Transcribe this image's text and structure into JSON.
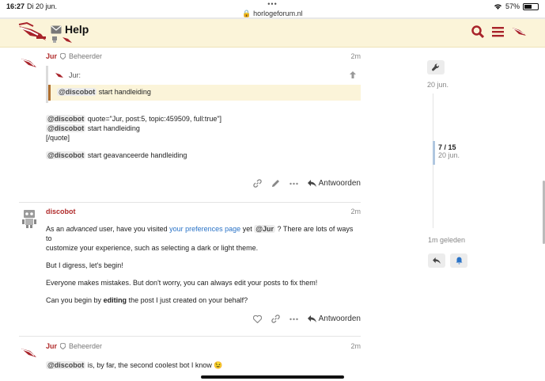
{
  "status": {
    "time": "16:27",
    "date": "Di 20 jun.",
    "url": "horlogeforum.nl",
    "battery": "57%",
    "battery_level": 0.57,
    "dots": "•••"
  },
  "header": {
    "title": "Help"
  },
  "posts": [
    {
      "username": "Jur",
      "role": "Beheerder",
      "time": "2m",
      "quote_author": "Jur:",
      "quote_mention": "@discobot",
      "quote_text": "start handleiding",
      "lines": [
        {
          "mention": "@discobot",
          "text": "quote=\"Jur, post:5, topic:459509, full:true\"]"
        },
        {
          "mention": "@discobot",
          "text": "start handleiding"
        },
        {
          "mention": "",
          "text": "[/quote]"
        },
        {
          "mention": "@discobot",
          "text": "start geavanceerde handleiding"
        }
      ],
      "reply_label": "Antwoorden"
    },
    {
      "username": "discobot",
      "time": "2m",
      "p1_a": "As an ",
      "p1_em": "advanced",
      "p1_b": " user, have you visited ",
      "p1_link": "your preferences page",
      "p1_c": " yet ",
      "p1_mention": "@Jur",
      "p1_d": " ? There are lots of ways to",
      "p1_e": "customize your experience, such as selecting a dark or light theme.",
      "p2": "But I digress, let's begin!",
      "p3": "Everyone makes mistakes. But don't worry, you can always edit your posts to fix them!",
      "p4_a": "Can you begin by ",
      "p4_b": "editing",
      "p4_c": " the post I just created on your behalf?",
      "reply_label": "Antwoorden"
    },
    {
      "username": "Jur",
      "role": "Beheerder",
      "time": "2m",
      "mention": "@discobot",
      "text": "is, by far, the second coolest bot I know",
      "emoji": "😉"
    }
  ],
  "timeline": {
    "top_date": "20 jun.",
    "position": "7 / 15",
    "position_date": "20 jun.",
    "bottom_label": "1m geleden"
  }
}
